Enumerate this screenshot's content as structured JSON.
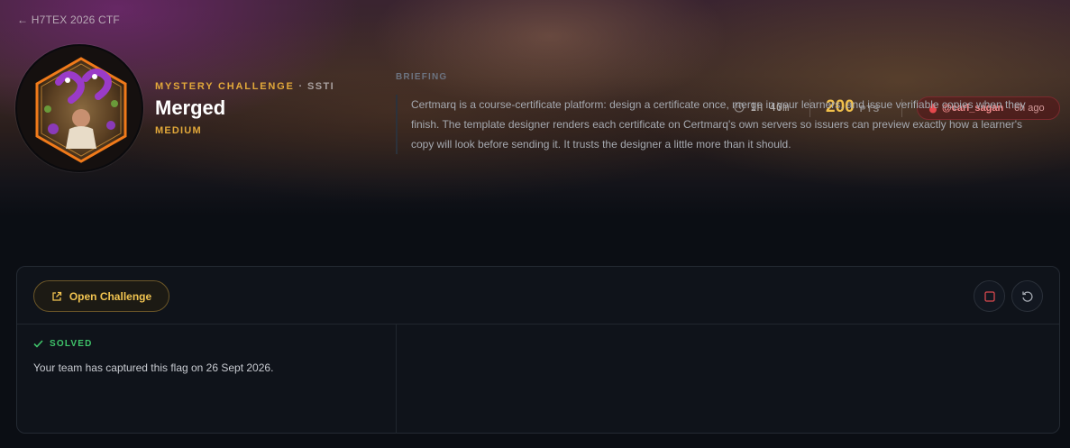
{
  "nav": {
    "back_label": "← H7TEX 2026 CTF"
  },
  "challenge": {
    "eyebrow": "MYSTERY CHALLENGE",
    "category": "· SSTI",
    "title": "Merged",
    "difficulty": "MEDIUM",
    "timer": "1h 40m",
    "points": "200",
    "points_unit": "PTS",
    "first_blood_user": "@carl_sagan",
    "first_blood_ago": "· 6h ago"
  },
  "actions": {
    "open_label": "Open Challenge"
  },
  "status": {
    "label": "SOLVED",
    "message": "Your team has captured this flag on 26 Sept 2026."
  },
  "briefing": {
    "label": "BRIEFING",
    "text": "Certmarq is a course-certificate platform: design a certificate once, merge in your learners, and issue verifiable copies when they finish. The template designer renders each certificate on Certmarq's own servers so issuers can preview exactly how a learner's copy will look before sending it. It trusts the designer a little more than it should."
  },
  "colors": {
    "accent": "#f0c350",
    "solved": "#3fc46a",
    "blood": "#f08a8c"
  },
  "icons": [
    "clock-icon",
    "blood-drop-icon",
    "external-link-icon",
    "stop-icon",
    "reset-icon",
    "check-icon",
    "challenge-avatar"
  ]
}
